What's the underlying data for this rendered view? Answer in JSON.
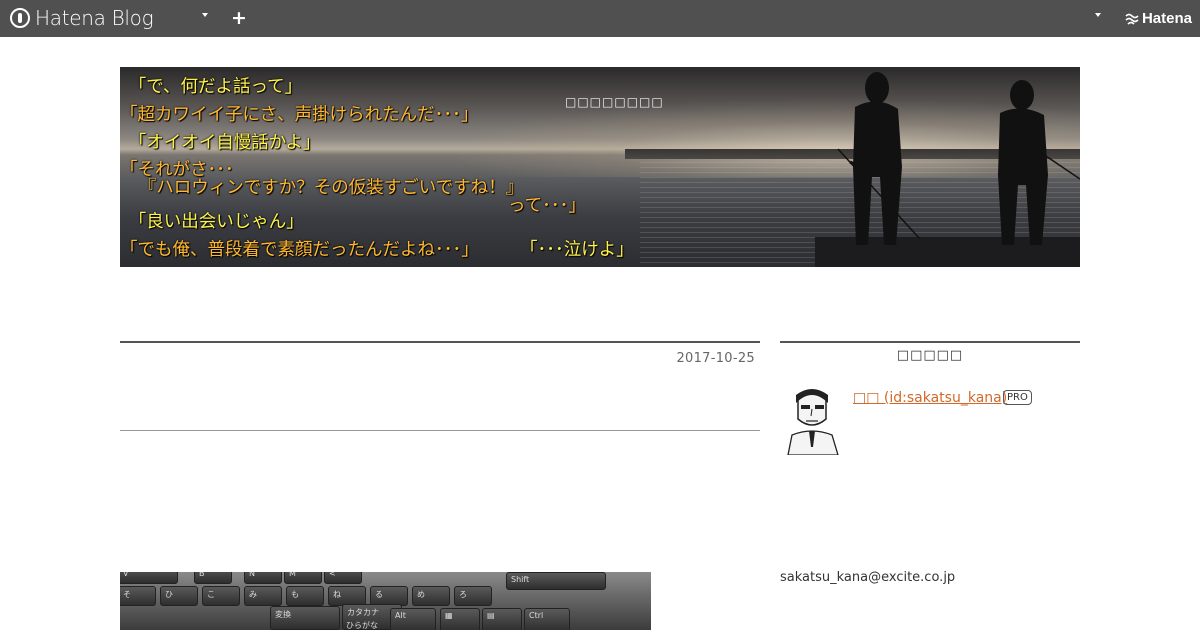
{
  "topbar": {
    "brand_name": "Hatena Blog",
    "plus_label": "+",
    "hatena_label": "Hatena"
  },
  "header": {
    "blog_title": "□□□□□□□□",
    "lines": [
      {
        "text": "　「で、何だよ話って」",
        "color": "yellow"
      },
      {
        "text": "「超カワイイ子にさ、声掛けられたんだ･･･」",
        "color": "orange"
      },
      {
        "text": "　「オイオイ自慢話かよ」",
        "color": "yellow"
      },
      {
        "text": "「それがさ･･･",
        "color": "orange"
      },
      {
        "text": "　『ハロウィンですか？その仮装すごいですね！』",
        "color": "orange"
      },
      {
        "text": "って･･･」",
        "color": "orange"
      },
      {
        "text": "　「良い出会いじゃん」",
        "color": "yellow"
      },
      {
        "text": "「でも俺、普段着で素顔だったんだよね･･･」",
        "color": "orange"
      },
      {
        "text": "「･･･泣けよ」",
        "color": "yellow"
      }
    ]
  },
  "entry": {
    "date": "2017-10-25"
  },
  "sidebar": {
    "heading": "□□□□□",
    "profile_link": "□□ (id:sakatsu_kana)",
    "badge": "PRO",
    "email": "sakatsu_kana@excite.co.jp"
  },
  "keyboard_keys": [
    "V",
    "B",
    "N",
    "M",
    "<",
    "Shift",
    "そ",
    "ひ",
    "こ",
    "み",
    "も",
    "ね",
    "る",
    "め",
    "ろ",
    "変換",
    "カタカナ",
    "ひらがな",
    "Alt",
    "Ctrl"
  ]
}
